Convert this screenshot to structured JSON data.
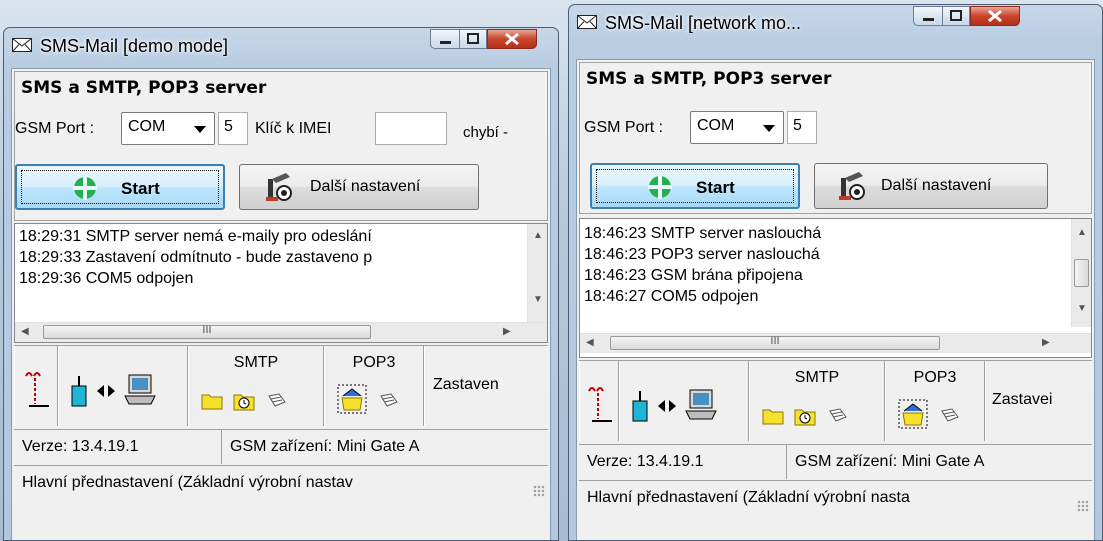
{
  "windows": [
    {
      "title": "SMS-Mail  [demo mode]",
      "group_title": "SMS a SMTP, POP3 server",
      "gsm_port_label": "GSM Port :",
      "gsm_port_value": "COM",
      "port_number": "5",
      "imei_label": "Klíč k IMEI",
      "imei_value": "",
      "missing_label": "chybí -",
      "start_label": "Start",
      "settings_label": "Další nastavení",
      "log": [
        "18:29:31  SMTP server nemá e-maily pro odeslání",
        "18:29:33  Zastavení odmítnuto - bude zastaveno p",
        "18:29:36  COM5 odpojen"
      ],
      "hscroll_grip": "III",
      "smtp_label": "SMTP",
      "pop3_label": "POP3",
      "state_label": "Zastaven",
      "version": "Verze: 13.4.19.1",
      "device": "GSM zařízení: Mini Gate A",
      "preset": "Hlavní přednastavení (Základní výrobní nastav"
    },
    {
      "title": "SMS-Mail  [network mo...",
      "group_title": "SMS a SMTP, POP3 server",
      "gsm_port_label": "GSM Port :",
      "gsm_port_value": "COM",
      "port_number": "5",
      "start_label": "Start",
      "settings_label": "Další nastavení",
      "log": [
        "18:46:23  SMTP server naslouchá",
        "18:46:23  POP3 server naslouchá",
        "18:46:23  GSM brána připojena",
        "18:46:27  COM5 odpojen"
      ],
      "hscroll_grip": "III",
      "smtp_label": "SMTP",
      "pop3_label": "POP3",
      "state_label": "Zastavei",
      "version": "Verze: 13.4.19.1",
      "device": "GSM zařízení: Mini Gate A",
      "preset": "Hlavní přednastavení (Základní výrobní nasta"
    }
  ],
  "colors": {
    "start_icon": "#22b14c",
    "folder": "#f5e12e",
    "antenna": "#c00000",
    "modem": "#1fb6d6"
  },
  "icons": [
    "envelope-icon",
    "minimize-icon",
    "maximize-icon",
    "close-icon",
    "start-icon",
    "settings-icon",
    "antenna-icon",
    "modem-icon",
    "transfer-icon",
    "computer-icon",
    "folder-icon",
    "clock-icon",
    "mail-tray-icon",
    "home-folder-icon"
  ]
}
